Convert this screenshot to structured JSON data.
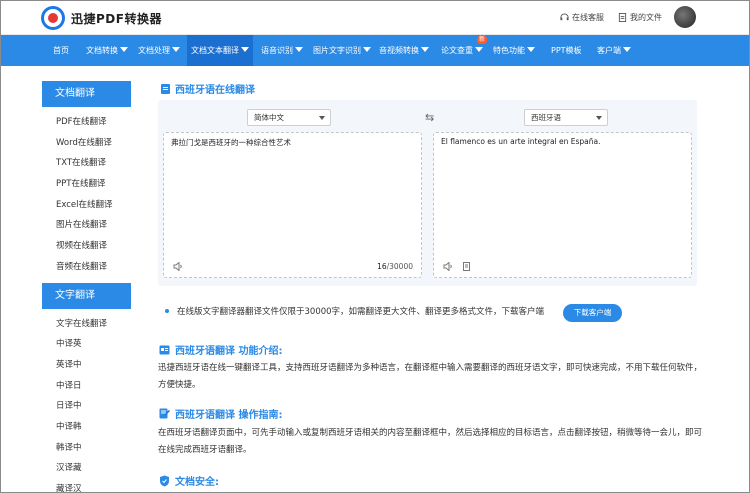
{
  "header": {
    "brand": "迅捷PDF转换器",
    "service": "在线客服",
    "my_files": "我的文件"
  },
  "nav": {
    "items": [
      "首页",
      "文档转换",
      "文档处理",
      "文档文本翻译",
      "语音识别",
      "图片文字识别",
      "音视频转换",
      "论文查重",
      "特色功能",
      "PPT模板",
      "客户端"
    ],
    "new_badge": "新"
  },
  "sidebar": {
    "group1_title": "文档翻译",
    "group1_items": [
      "PDF在线翻译",
      "Word在线翻译",
      "TXT在线翻译",
      "PPT在线翻译",
      "Excel在线翻译",
      "图片在线翻译",
      "视频在线翻译",
      "音频在线翻译"
    ],
    "group2_title": "文字翻译",
    "group2_items": [
      "文字在线翻译",
      "中译英",
      "英译中",
      "中译日",
      "日译中",
      "中译韩",
      "韩译中",
      "汉译藏",
      "藏译汉"
    ]
  },
  "main": {
    "title": "西班牙语在线翻译",
    "source_lang": "简体中文",
    "target_lang": "西班牙语",
    "source_text": "弗拉门戈是西班牙的一种综合性艺术",
    "target_text": "El flamenco es un arte integral en España.",
    "char_count": "16",
    "char_limit": "/30000",
    "note": "在线版文字翻译器翻译文件仅限于30000字，如需翻译更大文件、翻译更多格式文件，下载客户端",
    "download_button": "下载客户端",
    "intro_title": "西班牙语翻译 功能介绍:",
    "intro_text": "迅捷西班牙语在线一键翻译工具，支持西班牙语翻译为多种语言，在翻译框中输入需要翻译的西班牙语文字，即可快速完成，不用下载任何软件，方便快捷。",
    "guide_title": "西班牙语翻译 操作指南:",
    "guide_text": "在西班牙语翻译页面中，可先手动输入或复制西班牙语相关的内容至翻译框中，然后选择相应的目标语言，点击翻译按钮，稍微等待一会儿，即可在线完成西班牙语翻译。",
    "security_title": "文档安全:"
  }
}
